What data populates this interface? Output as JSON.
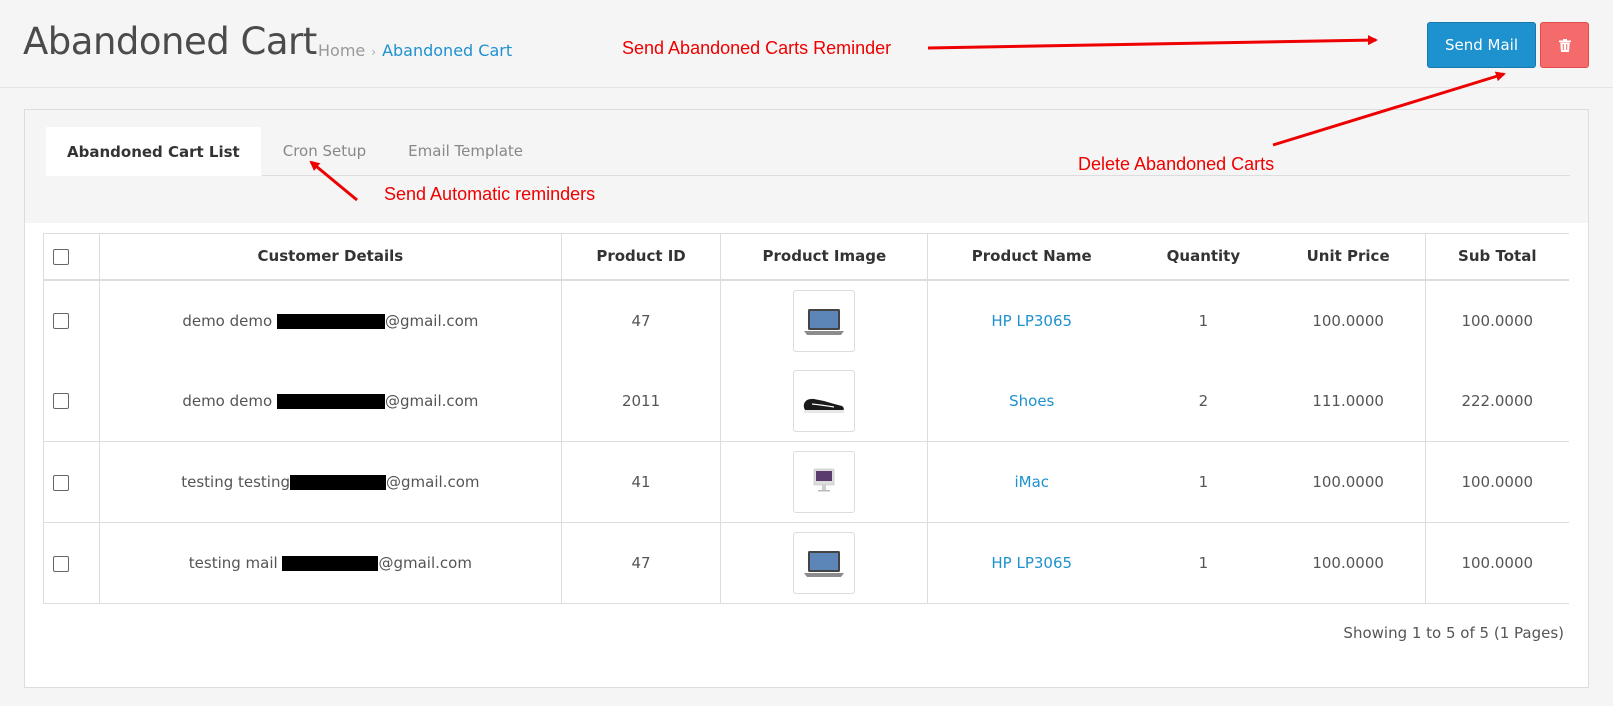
{
  "header": {
    "title": "Abandoned Cart",
    "breadcrumb": {
      "home": "Home",
      "separator": "›",
      "current": "Abandoned Cart"
    },
    "send_button": "Send Mail",
    "delete_icon": "trash-icon"
  },
  "tabs": [
    {
      "label": "Abandoned Cart List",
      "active": true
    },
    {
      "label": "Cron Setup",
      "active": false
    },
    {
      "label": "Email Template",
      "active": false
    }
  ],
  "table": {
    "columns": [
      "Customer Details",
      "Product ID",
      "Product Image",
      "Product Name",
      "Quantity",
      "Unit Price",
      "Sub Total"
    ],
    "rows": [
      {
        "customer_prefix": "demo demo",
        "customer_suffix": "@gmail.com",
        "product_id": "47",
        "image": "laptop",
        "product_name": "HP LP3065",
        "quantity": "1",
        "unit_price": "100.0000",
        "sub_total": "100.0000"
      },
      {
        "customer_prefix": "demo demo",
        "customer_suffix": "@gmail.com",
        "product_id": "2011",
        "image": "shoe",
        "product_name": "Shoes",
        "quantity": "2",
        "unit_price": "111.0000",
        "sub_total": "222.0000"
      },
      {
        "customer_prefix": "testing testing",
        "customer_suffix": "@gmail.com",
        "product_id": "41",
        "image": "imac",
        "product_name": "iMac",
        "quantity": "1",
        "unit_price": "100.0000",
        "sub_total": "100.0000"
      },
      {
        "customer_prefix": "testing mail",
        "customer_suffix": "@gmail.com",
        "product_id": "47",
        "image": "laptop",
        "product_name": "HP LP3065",
        "quantity": "1",
        "unit_price": "100.0000",
        "sub_total": "100.0000"
      }
    ]
  },
  "pagination": {
    "text": "Showing 1 to 5 of 5 (1 Pages)"
  },
  "annotations": {
    "send_reminder": "Send Abandoned Carts Reminder",
    "delete_carts": "Delete Abandoned Carts",
    "automatic": "Send Automatic reminders"
  },
  "colors": {
    "primary": "#1e91cf",
    "danger": "#f56b6b",
    "annotation": "#ee0000"
  }
}
